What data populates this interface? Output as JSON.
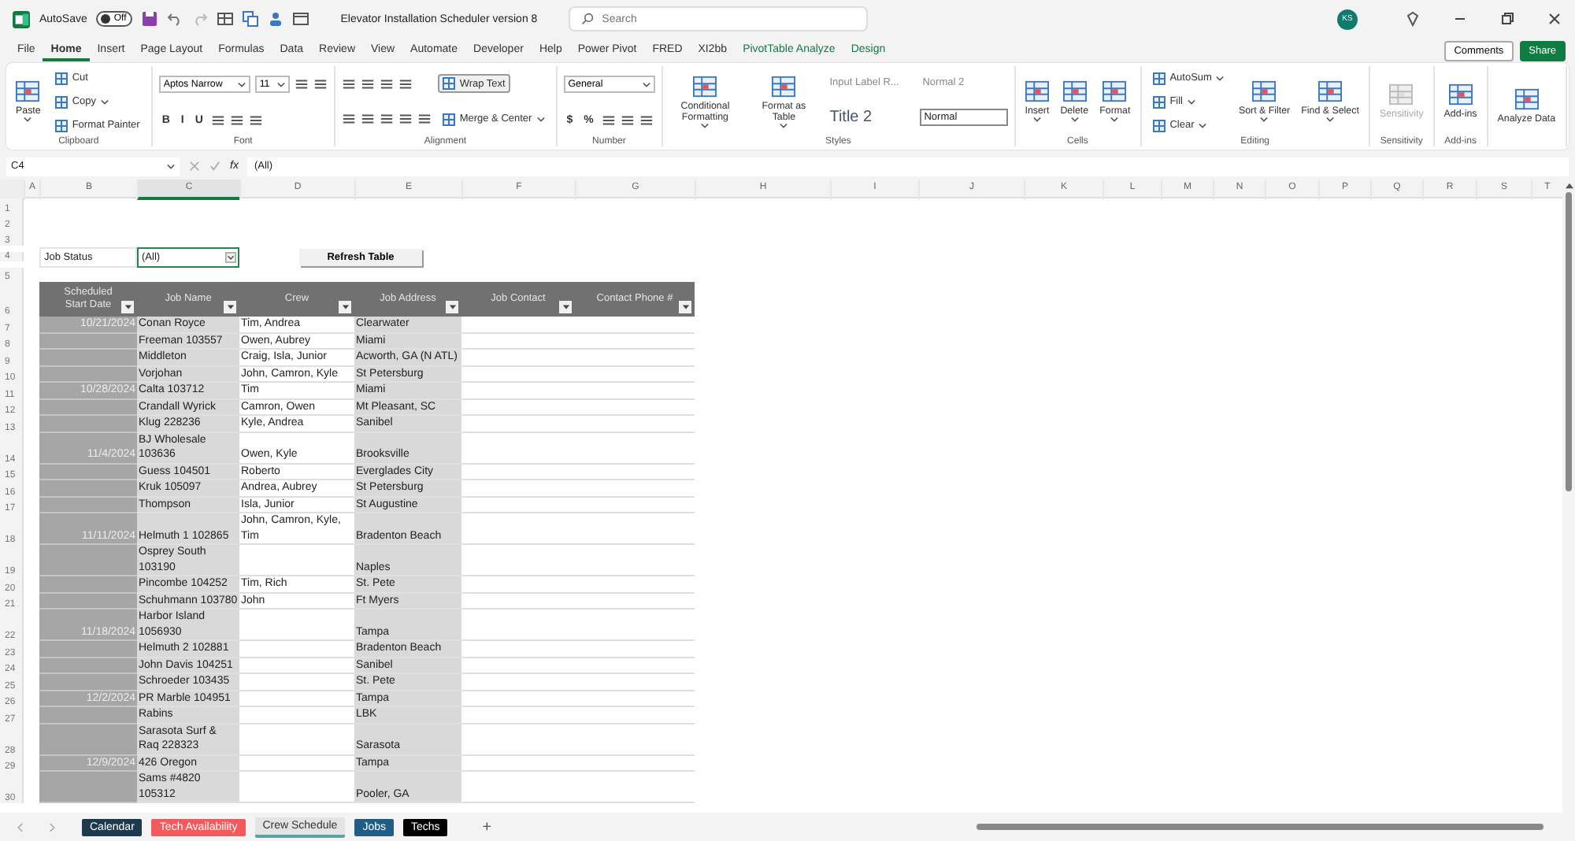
{
  "title_bar": {
    "autosave_label": "AutoSave",
    "autosave": {
      "label": "Off",
      "on": false
    },
    "document_title": "Elevator Installation Scheduler version 8",
    "search": {
      "placeholder": "Search"
    },
    "avatar": "KS"
  },
  "menu_tabs": [
    {
      "label": "File",
      "selected": false,
      "kind": "standard"
    },
    {
      "label": "Home",
      "selected": true,
      "kind": "standard"
    },
    {
      "label": "Insert",
      "selected": false,
      "kind": "standard"
    },
    {
      "label": "Page Layout",
      "selected": false,
      "kind": "standard"
    },
    {
      "label": "Formulas",
      "selected": false,
      "kind": "standard"
    },
    {
      "label": "Data",
      "selected": false,
      "kind": "standard"
    },
    {
      "label": "Review",
      "selected": false,
      "kind": "standard"
    },
    {
      "label": "View",
      "selected": false,
      "kind": "standard"
    },
    {
      "label": "Automate",
      "selected": false,
      "kind": "standard"
    },
    {
      "label": "Developer",
      "selected": false,
      "kind": "standard"
    },
    {
      "label": "Help",
      "selected": false,
      "kind": "standard"
    },
    {
      "label": "Power Pivot",
      "selected": false,
      "kind": "standard"
    },
    {
      "label": "FRED",
      "selected": false,
      "kind": "standard"
    },
    {
      "label": "XI2bb",
      "selected": false,
      "kind": "standard"
    },
    {
      "label": "PivotTable Analyze",
      "selected": false,
      "kind": "contextual"
    },
    {
      "label": "Design",
      "selected": false,
      "kind": "contextual"
    }
  ],
  "comments_button": "Comments",
  "share_button": "Share",
  "ribbon": [
    {
      "label": "Clipboard",
      "columns": [
        {
          "rows": [
            {
              "items": [
                {
                  "kind": "large",
                  "label": "Paste",
                  "menu": true
                }
              ]
            }
          ]
        },
        {
          "rows": [
            {
              "items": [
                {
                  "kind": "small",
                  "label": "Cut"
                }
              ]
            },
            {
              "items": [
                {
                  "kind": "small",
                  "label": "Copy",
                  "menu": true
                }
              ]
            },
            {
              "items": [
                {
                  "kind": "small",
                  "label": "Format Painter"
                }
              ]
            }
          ]
        }
      ]
    },
    {
      "label": "Font",
      "columns": [
        {
          "rows": [
            {
              "items": [
                {
                  "kind": "field",
                  "label": "Aptos Narrow"
                },
                {
                  "kind": "narrow-field",
                  "label": "11"
                },
                {
                  "kind": "icon"
                },
                {
                  "kind": "icon"
                }
              ]
            },
            {
              "items": [
                {
                  "kind": "glyph",
                  "label": "B"
                },
                {
                  "kind": "glyph",
                  "label": "I"
                },
                {
                  "kind": "glyph",
                  "label": "U"
                },
                {
                  "kind": "icon"
                },
                {
                  "kind": "icon"
                },
                {
                  "kind": "icon"
                }
              ]
            }
          ]
        }
      ]
    },
    {
      "label": "Alignment",
      "columns": [
        {
          "rows": [
            {
              "items": [
                {
                  "kind": "icon"
                },
                {
                  "kind": "icon"
                },
                {
                  "kind": "icon"
                },
                {
                  "kind": "icon"
                }
              ]
            },
            {
              "items": [
                {
                  "kind": "icon"
                },
                {
                  "kind": "icon"
                },
                {
                  "kind": "icon"
                },
                {
                  "kind": "icon"
                },
                {
                  "kind": "icon"
                }
              ]
            }
          ]
        },
        {
          "rows": [
            {
              "items": [
                {
                  "kind": "small",
                  "label": "Wrap Text",
                  "pressed": true
                }
              ]
            },
            {
              "items": [
                {
                  "kind": "small",
                  "label": "Merge & Center",
                  "menu": true,
                  "pressed": false
                }
              ]
            }
          ]
        }
      ]
    },
    {
      "label": "Number",
      "columns": [
        {
          "rows": [
            {
              "items": [
                {
                  "kind": "field",
                  "label": "General"
                }
              ]
            },
            {
              "items": [
                {
                  "kind": "glyph",
                  "label": "$"
                },
                {
                  "kind": "glyph",
                  "label": "%"
                },
                {
                  "kind": "icon"
                },
                {
                  "kind": "icon"
                },
                {
                  "kind": "icon"
                }
              ]
            }
          ]
        }
      ]
    },
    {
      "label": "Styles",
      "columns": [
        {
          "rows": [
            {
              "items": [
                {
                  "kind": "large",
                  "label": "Conditional Formatting",
                  "menu": true
                }
              ]
            }
          ]
        },
        {
          "rows": [
            {
              "items": [
                {
                  "kind": "large",
                  "label": "Format as Table",
                  "menu": true
                }
              ]
            }
          ]
        },
        {
          "rows": [
            {
              "items": [
                {
                  "kind": "style",
                  "label": "Input Label R..."
                },
                {
                  "kind": "style",
                  "label": "Normal 2"
                }
              ]
            },
            {
              "items": [
                {
                  "kind": "style-title",
                  "label": "Title 2"
                },
                {
                  "kind": "style-boxed",
                  "label": "Normal"
                }
              ]
            }
          ]
        }
      ]
    },
    {
      "label": "Cells",
      "columns": [
        {
          "rows": [
            {
              "items": [
                {
                  "kind": "large",
                  "label": "Insert",
                  "menu": true
                },
                {
                  "kind": "large",
                  "label": "Delete",
                  "menu": true
                },
                {
                  "kind": "large",
                  "label": "Format",
                  "menu": true
                }
              ]
            }
          ]
        }
      ]
    },
    {
      "label": "Editing",
      "columns": [
        {
          "rows": [
            {
              "items": [
                {
                  "kind": "small",
                  "label": "AutoSum",
                  "menu": true
                }
              ]
            },
            {
              "items": [
                {
                  "kind": "small",
                  "label": "Fill",
                  "menu": true
                }
              ]
            },
            {
              "items": [
                {
                  "kind": "small",
                  "label": "Clear",
                  "menu": true
                }
              ]
            }
          ]
        },
        {
          "rows": [
            {
              "items": [
                {
                  "kind": "large",
                  "label": "Sort & Filter",
                  "menu": true
                },
                {
                  "kind": "large",
                  "label": "Find & Select",
                  "menu": true
                }
              ]
            }
          ]
        }
      ]
    },
    {
      "label": "Sensitivity",
      "columns": [
        {
          "rows": [
            {
              "items": [
                {
                  "kind": "large",
                  "label": "Sensitivity",
                  "disabled": true
                }
              ]
            }
          ]
        }
      ]
    },
    {
      "label": "Add-ins",
      "columns": [
        {
          "rows": [
            {
              "items": [
                {
                  "kind": "large",
                  "label": "Add-ins"
                }
              ]
            }
          ]
        }
      ]
    },
    {
      "columns": [
        {
          "rows": [
            {
              "items": [
                {
                  "kind": "large",
                  "label": "Analyze Data"
                }
              ]
            }
          ]
        }
      ]
    }
  ],
  "formula_bar": {
    "name_box": "C4",
    "fx": "fx",
    "formula": "(All)"
  },
  "sheet": {
    "columns": [
      {
        "label": "A",
        "selected": false
      },
      {
        "label": "B",
        "selected": false
      },
      {
        "label": "C",
        "selected": true
      },
      {
        "label": "D",
        "selected": false
      },
      {
        "label": "E",
        "selected": false
      },
      {
        "label": "F",
        "selected": false
      },
      {
        "label": "G",
        "selected": false
      },
      {
        "label": "H",
        "selected": false
      },
      {
        "label": "I",
        "selected": false
      },
      {
        "label": "J",
        "selected": false
      },
      {
        "label": "K",
        "selected": false
      },
      {
        "label": "L",
        "selected": false
      },
      {
        "label": "M",
        "selected": false
      },
      {
        "label": "N",
        "selected": false
      },
      {
        "label": "O",
        "selected": false
      },
      {
        "label": "P",
        "selected": false
      },
      {
        "label": "Q",
        "selected": false
      },
      {
        "label": "R",
        "selected": false
      },
      {
        "label": "S",
        "selected": false
      },
      {
        "label": "T",
        "selected": false
      }
    ],
    "rows_above": [
      "1",
      "2",
      "3"
    ],
    "filter_row": {
      "number": "4",
      "label": "Job Status",
      "value": "(All)",
      "button": "Refresh Table"
    },
    "spacer_row": "5",
    "header_row": {
      "number": "6",
      "headers": [
        "Scheduled Start Date",
        "Job Name",
        "Crew",
        "Job Address",
        "Job Contact",
        "Contact Phone #"
      ]
    },
    "rows": [
      {
        "number": "7",
        "date": "10/21/2024",
        "job": "Conan Royce",
        "crew": "Tim, Andrea",
        "address": "Clearwater"
      },
      {
        "number": "8",
        "job": "Freeman 103557",
        "crew": "Owen, Aubrey",
        "address": "Miami"
      },
      {
        "number": "9",
        "job": "Middleton",
        "crew": "Craig, Isla, Junior",
        "address": "Acworth, GA (N ATL)"
      },
      {
        "number": "10",
        "job": "Vorjohan",
        "crew": "John, Camron, Kyle",
        "address": "St Petersburg"
      },
      {
        "number": "11",
        "date": "10/28/2024",
        "job": "Calta 103712",
        "crew": "Tim",
        "address": "Miami"
      },
      {
        "number": "12",
        "job": "Crandall Wyrick",
        "crew": "Camron, Owen",
        "address": "Mt Pleasant, SC"
      },
      {
        "number": "13",
        "job": "Klug 228236",
        "crew": "Kyle, Andrea",
        "address": "Sanibel"
      },
      {
        "number": "14",
        "date": "11/4/2024",
        "job": "BJ Wholesale 103636",
        "crew": "Owen, Kyle",
        "address": "Brooksville"
      },
      {
        "number": "15",
        "job": "Guess 104501",
        "crew": "Roberto",
        "address": "Everglades City"
      },
      {
        "number": "16",
        "job": "Kruk 105097",
        "crew": "Andrea, Aubrey",
        "address": "St Petersburg"
      },
      {
        "number": "17",
        "job": "Thompson",
        "crew": "Isla, Junior",
        "address": "St Augustine"
      },
      {
        "number": "18",
        "date": "11/11/2024",
        "job": "Helmuth 1  102865",
        "crew": "John, Camron, Kyle, Tim",
        "address": "Bradenton Beach"
      },
      {
        "number": "19",
        "job": "Osprey South 103190",
        "address": "Naples"
      },
      {
        "number": "20",
        "job": "Pincombe 104252",
        "crew": "Tim, Rich",
        "address": "St. Pete"
      },
      {
        "number": "21",
        "job": "Schuhmann 103780",
        "crew": "John",
        "address": "Ft Myers"
      },
      {
        "number": "22",
        "date": "11/18/2024",
        "job": "Harbor Island 1056930",
        "address": "Tampa"
      },
      {
        "number": "23",
        "job": "Helmuth 2 102881",
        "address": "Bradenton Beach"
      },
      {
        "number": "24",
        "job": "John Davis 104251",
        "address": "Sanibel"
      },
      {
        "number": "25",
        "job": "Schroeder 103435",
        "address": "St. Pete"
      },
      {
        "number": "26",
        "date": "12/2/2024",
        "job": "PR Marble 104951",
        "address": "Tampa"
      },
      {
        "number": "27",
        "job": "Rabins",
        "address": "LBK"
      },
      {
        "number": "28",
        "job": "Sarasota Surf & Raq 228323",
        "address": "Sarasota"
      },
      {
        "number": "29",
        "date": "12/9/2024",
        "job": "426 Oregon",
        "address": "Tampa"
      },
      {
        "number": "30",
        "job": "Sams #4820 105312",
        "address": "Pooler, GA"
      }
    ]
  },
  "sheet_tabs": [
    {
      "label": "Calendar",
      "color": "#1d3a4c",
      "selected": false
    },
    {
      "label": "Tech Availability",
      "color": "#f25a5e",
      "selected": false
    },
    {
      "label": "Crew Schedule",
      "color": "#5aa5a0",
      "selected": true
    },
    {
      "label": "Jobs",
      "color": "#1f5d85",
      "selected": false
    },
    {
      "label": "Techs",
      "color": "#000000",
      "selected": false
    }
  ],
  "add_sheet": "+"
}
